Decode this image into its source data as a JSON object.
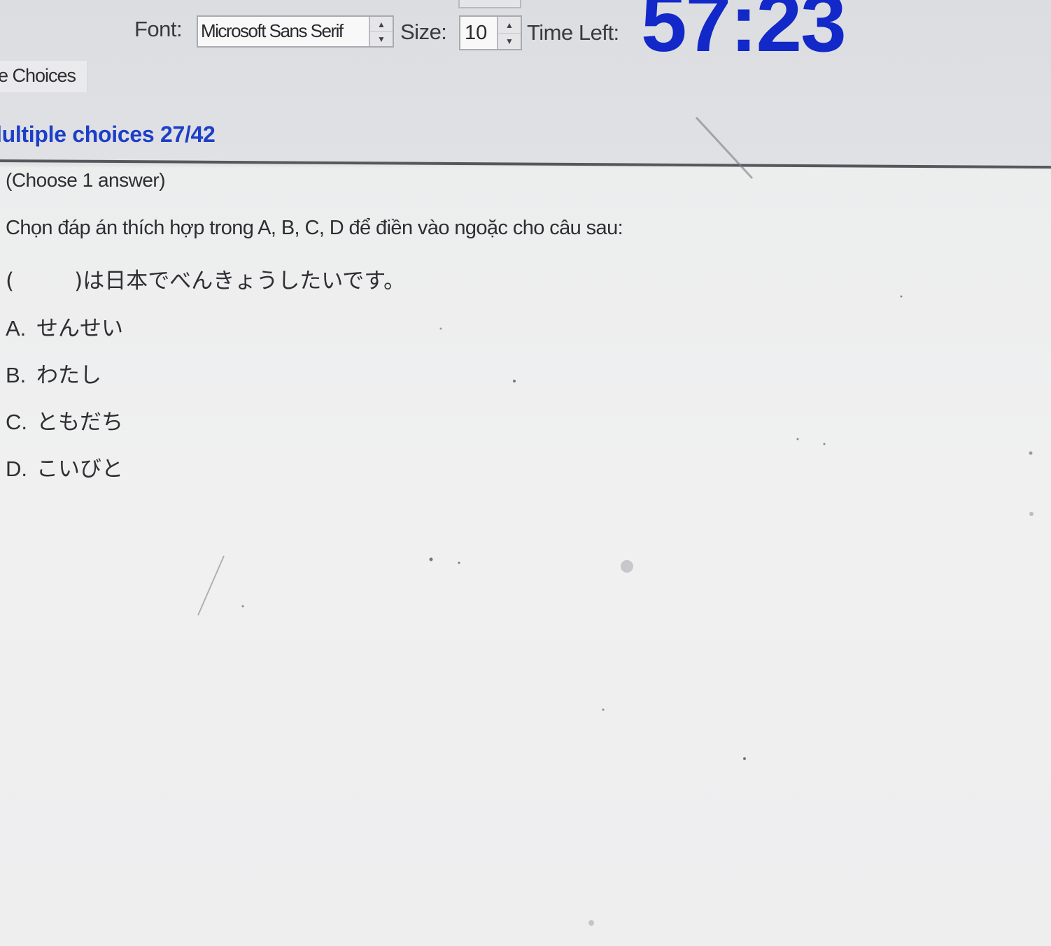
{
  "toolbar": {
    "font_label": "Font:",
    "font_value": "Microsoft Sans Serif",
    "size_label": "Size:",
    "size_value": "10",
    "time_left_label": "Time Left:",
    "timer": "57:23",
    "spin_up_icon": "spin-up-icon",
    "spin_down_icon": "spin-down-icon"
  },
  "tab": {
    "label": "le Choices"
  },
  "section": {
    "title": "lultiple choices 27/42"
  },
  "question": {
    "instruction": "(Choose 1 answer)",
    "prompt": "Chọn đáp án thích hợp trong A, B, C, D để điền vào ngoặc cho câu sau:",
    "sentence_open": "(",
    "sentence_rest": ")は日本でべんきょうしたいです。",
    "options": [
      {
        "letter": "A.",
        "text": "せんせい"
      },
      {
        "letter": "B.",
        "text": "わたし"
      },
      {
        "letter": "C.",
        "text": "ともだち"
      },
      {
        "letter": "D.",
        "text": "こいびと"
      }
    ]
  },
  "colors": {
    "timer": "#1228c8",
    "section_title": "#1d3fc8",
    "text": "#2e2e33"
  }
}
